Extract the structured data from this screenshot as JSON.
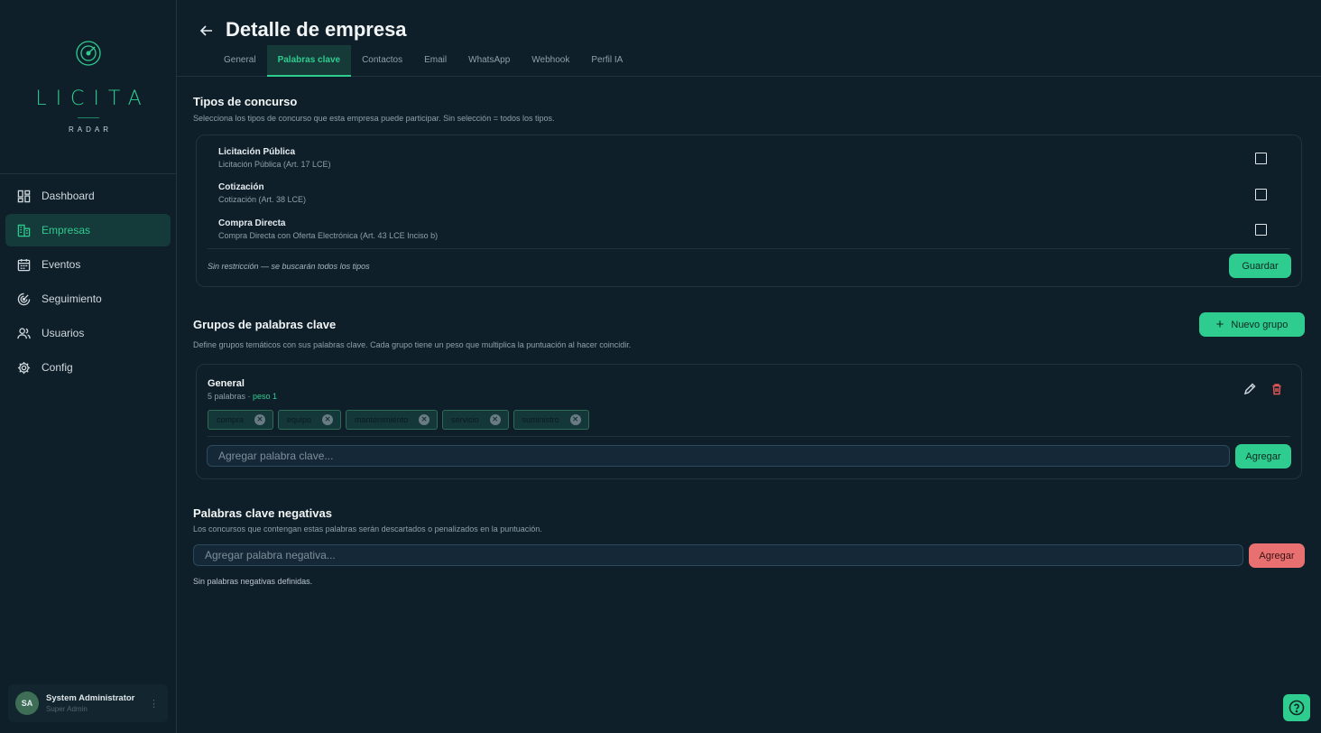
{
  "brand": {
    "name": "LICITA",
    "sub": "RADAR",
    "accent": "#2ecc8f"
  },
  "nav": [
    {
      "label": "Dashboard",
      "icon": "dashboard-icon",
      "active": false
    },
    {
      "label": "Empresas",
      "icon": "building-icon",
      "active": true
    },
    {
      "label": "Eventos",
      "icon": "calendar-icon",
      "active": false
    },
    {
      "label": "Seguimiento",
      "icon": "radar-icon",
      "active": false
    },
    {
      "label": "Usuarios",
      "icon": "users-icon",
      "active": false
    },
    {
      "label": "Config",
      "icon": "gear-icon",
      "active": false
    }
  ],
  "user": {
    "initials": "SA",
    "name": "System Administrator",
    "role": "Super Admin"
  },
  "header": {
    "title": "Detalle de empresa",
    "tabs": [
      "General",
      "Palabras clave",
      "Contactos",
      "Email",
      "WhatsApp",
      "Webhook",
      "Perfil IA"
    ],
    "active_tab": "Palabras clave"
  },
  "tipos": {
    "title": "Tipos de concurso",
    "desc": "Selecciona los tipos de concurso que esta empresa puede participar. Sin selección = todos los tipos.",
    "items": [
      {
        "name": "Licitación Pública",
        "desc": "Licitación Pública (Art. 17 LCE)",
        "checked": false
      },
      {
        "name": "Cotización",
        "desc": "Cotización (Art. 38 LCE)",
        "checked": false
      },
      {
        "name": "Compra Directa",
        "desc": "Compra Directa con Oferta Electrónica (Art. 43 LCE Inciso b)",
        "checked": false
      }
    ],
    "note": "Sin restricción — se buscarán todos los tipos",
    "save_label": "Guardar"
  },
  "grupos": {
    "title": "Grupos de palabras clave",
    "desc": "Define grupos temáticos con sus palabras clave. Cada grupo tiene un peso que multiplica la puntuación al hacer coincidir.",
    "new_label": "Nuevo grupo",
    "group": {
      "name": "General",
      "count": "5 palabras · ",
      "peso": "peso 1",
      "keywords": [
        "compra",
        "equipo",
        "mantenimiento",
        "servicio",
        "suministro"
      ],
      "input_placeholder": "Agregar palabra clave...",
      "add_label": "Agregar"
    }
  },
  "negativas": {
    "title": "Palabras clave negativas",
    "desc": "Los concursos que contengan estas palabras serán descartados o penalizados en la puntuación.",
    "input_placeholder": "Agregar palabra negativa...",
    "add_label": "Agregar",
    "empty": "Sin palabras negativas definidas."
  }
}
